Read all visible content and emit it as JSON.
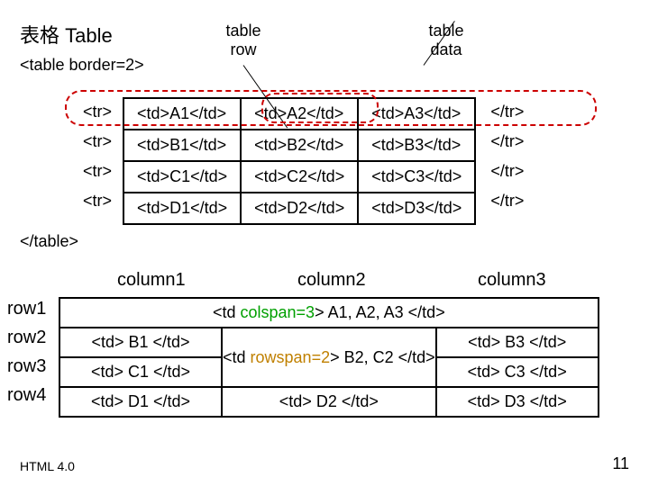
{
  "header": {
    "title": "表格 Table",
    "table_open": "<table border=2>",
    "table_close": "</table>",
    "callout_row": "table row",
    "callout_data": "table data"
  },
  "eg1": {
    "tr_open": "<tr>",
    "tr_close": "</tr>",
    "rows": [
      [
        "<td>A1</td>",
        "<td>A2</td>",
        "<td>A3</td>"
      ],
      [
        "<td>B1</td>",
        "<td>B2</td>",
        "<td>B3</td>"
      ],
      [
        "<td>C1</td>",
        "<td>C2</td>",
        "<td>C3</td>"
      ],
      [
        "<td>D1</td>",
        "<td>D2</td>",
        "<td>D3</td>"
      ]
    ]
  },
  "eg2": {
    "col_headers": [
      "column1",
      "column2",
      "column3"
    ],
    "row_labels": [
      "row1",
      "row2",
      "row3",
      "row4"
    ],
    "r1": {
      "pre": "<td ",
      "attr": "colspan=3",
      "post": "> A1, A2, A3 </td>"
    },
    "r2": {
      "c1": "<td> B1 </td>",
      "rs_pre": "<td ",
      "rs_attr": "rowspan=2",
      "rs_post": "> B2, C2 </td>",
      "c3": "<td> B3 </td>"
    },
    "r3": {
      "c1": "<td> C1 </td>",
      "c3": "<td> C3 </td>"
    },
    "r4": {
      "c1": "<td> D1 </td>",
      "c2": "<td> D2 </td>",
      "c3": "<td> D3 </td>"
    }
  },
  "footer": {
    "left": "HTML 4.0",
    "right": "11"
  }
}
